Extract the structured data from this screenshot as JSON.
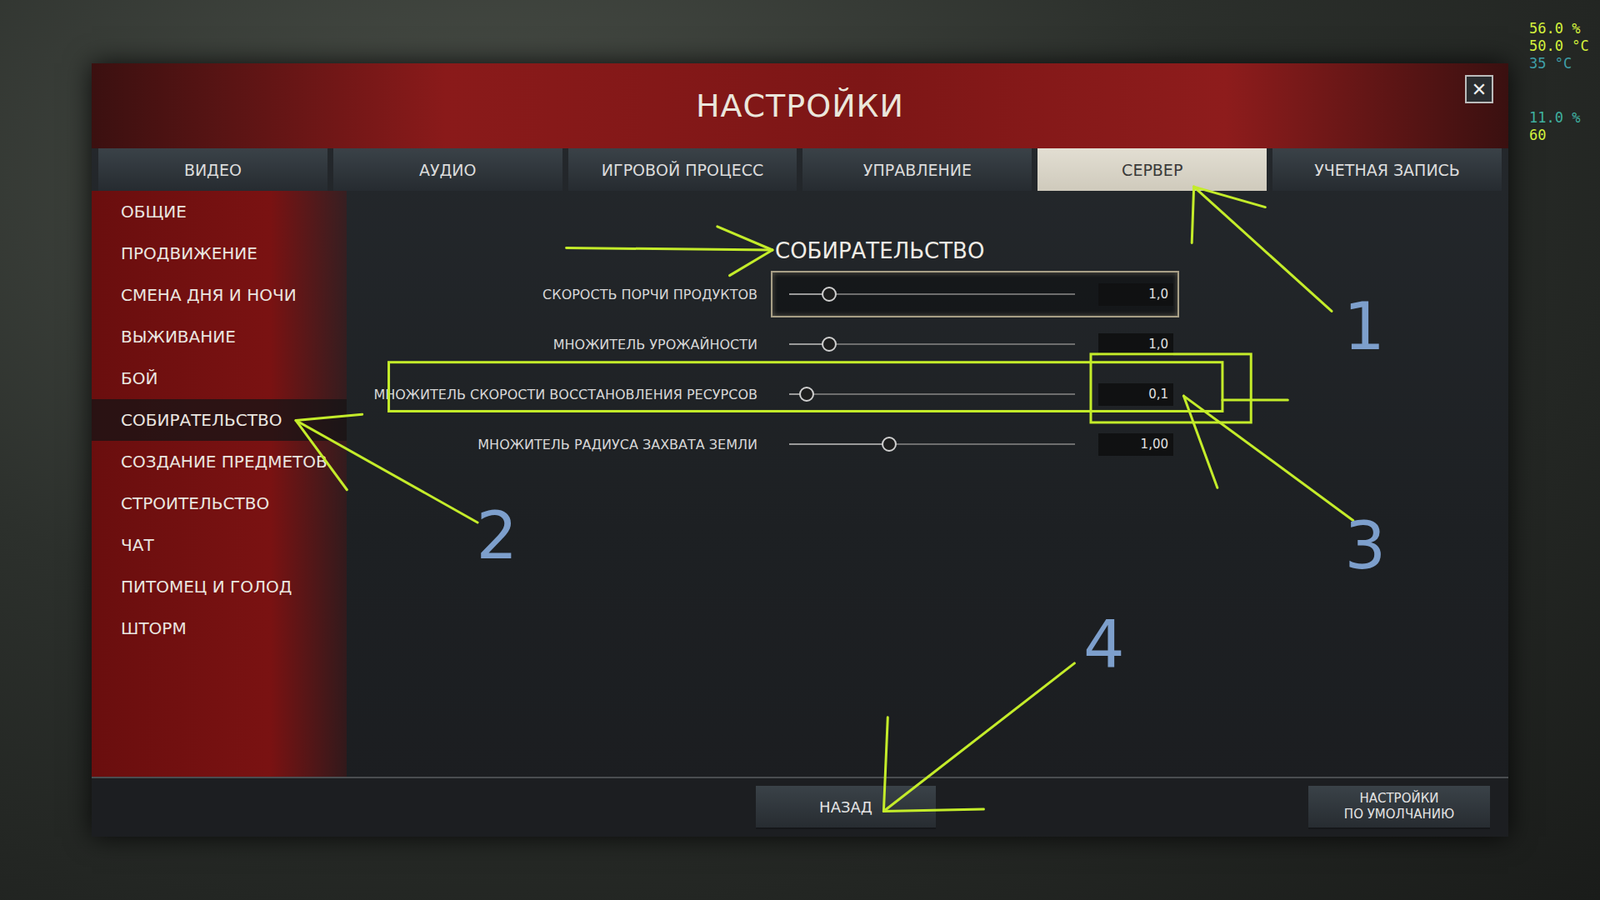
{
  "window": {
    "title": "НАСТРОЙКИ",
    "close": "✕"
  },
  "tabs": [
    {
      "label": "ВИДЕО",
      "selected": false
    },
    {
      "label": "АУДИО",
      "selected": false
    },
    {
      "label": "ИГРОВОЙ ПРОЦЕСС",
      "selected": false
    },
    {
      "label": "УПРАВЛЕНИЕ",
      "selected": false
    },
    {
      "label": "СЕРВЕР",
      "selected": true
    },
    {
      "label": "УЧЕТНАЯ ЗАПИСЬ",
      "selected": false
    }
  ],
  "sidebar": {
    "items": [
      {
        "label": "ОБЩИЕ",
        "selected": false
      },
      {
        "label": "ПРОДВИЖЕНИЕ",
        "selected": false
      },
      {
        "label": "СМЕНА ДНЯ И НОЧИ",
        "selected": false
      },
      {
        "label": "ВЫЖИВАНИЕ",
        "selected": false
      },
      {
        "label": "БОЙ",
        "selected": false
      },
      {
        "label": "СОБИРАТЕЛЬСТВО",
        "selected": true
      },
      {
        "label": "СОЗДАНИЕ ПРЕДМЕТОВ",
        "selected": false
      },
      {
        "label": "СТРОИТЕЛЬСТВО",
        "selected": false
      },
      {
        "label": "ЧАТ",
        "selected": false
      },
      {
        "label": "ПИТОМЕЦ И ГОЛОД",
        "selected": false
      },
      {
        "label": "ШТОРМ",
        "selected": false
      }
    ]
  },
  "section": {
    "title": "СОБИРАТЕЛЬСТВО",
    "rows": [
      {
        "label": "СКОРОСТЬ ПОРЧИ ПРОДУКТОВ",
        "level": 0.14,
        "value": "1,0",
        "hovered": true
      },
      {
        "label": "МНОЖИТЕЛЬ УРОЖАЙНОСТИ",
        "level": 0.14,
        "value": "1,0",
        "hovered": false
      },
      {
        "label": "МНОЖИТЕЛЬ СКОРОСТИ ВОССТАНОВЛЕНИЯ РЕСУРСОВ",
        "level": 0.06,
        "value": "0,1",
        "hovered": false
      },
      {
        "label": "МНОЖИТЕЛЬ РАДИУСА ЗАХВАТА ЗЕМЛИ",
        "level": 0.35,
        "value": "1,00",
        "hovered": false
      }
    ]
  },
  "buttons": {
    "back": "НАЗАД",
    "defaults": [
      "НАСТРОЙКИ",
      "ПО УМОЛЧАНИЮ"
    ]
  },
  "overlay": {
    "groups": [
      [
        {
          "text": "56.0 %",
          "color": "#d4f23c"
        },
        {
          "text": "50.0 °C",
          "color": "#d4f23c"
        },
        {
          "text": "35 °C",
          "color": "#3f9fa8"
        }
      ],
      [
        {
          "text": "11.0 %",
          "color": "#3fb0a0"
        },
        {
          "text": "60",
          "color": "#d4f23c"
        }
      ]
    ]
  },
  "annotations": {
    "markers": [
      "1",
      "2",
      "3",
      "4"
    ]
  }
}
